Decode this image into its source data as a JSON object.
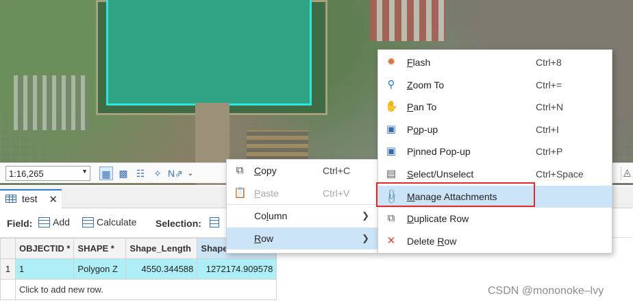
{
  "map": {
    "scale": "1:16,265"
  },
  "table_pane": {
    "tab_label": "test",
    "toolbar": {
      "field_label": "Field:",
      "add_label": "Add",
      "calculate_label": "Calculate",
      "selection_label": "Selection:"
    },
    "columns": [
      "OBJECTID *",
      "SHAPE *",
      "Shape_Length",
      "Shape_Area"
    ],
    "visible_column_headers": [
      "OBJECTID *",
      "SHAPE *",
      "Shape_Length",
      "Shape"
    ],
    "rows": [
      {
        "rownum": "1",
        "objectid": "1",
        "shape": "Polygon Z",
        "shape_length": "4550.344588",
        "shape_area": "1272174.909578"
      }
    ],
    "add_row_text": "Click to add new row."
  },
  "row_menu": {
    "items": [
      {
        "label": "Copy",
        "shortcut": "Ctrl+C",
        "icon": "copy-icon",
        "enabled": true
      },
      {
        "label": "Paste",
        "shortcut": "Ctrl+V",
        "icon": "paste-icon",
        "enabled": false
      },
      {
        "label": "Column",
        "submenu": true
      },
      {
        "label": "Row",
        "submenu": true,
        "highlighted": true
      }
    ]
  },
  "row_submenu": {
    "items": [
      {
        "label": "Flash",
        "shortcut": "Ctrl+8",
        "icon": "flash-icon"
      },
      {
        "label": "Zoom To",
        "shortcut": "Ctrl+=",
        "icon": "zoom-icon"
      },
      {
        "label": "Pan To",
        "shortcut": "Ctrl+N",
        "icon": "pan-hand-icon"
      },
      {
        "label": "Pop-up",
        "shortcut": "Ctrl+I",
        "icon": "popup-icon"
      },
      {
        "label": "Pinned Pop-up",
        "shortcut": "Ctrl+P",
        "icon": "pinned-popup-icon"
      },
      {
        "label": "Select/Unselect",
        "shortcut": "Ctrl+Space",
        "icon": "select-toggle-icon"
      },
      {
        "label": "Manage Attachments",
        "shortcut": "",
        "icon": "paperclip-icon",
        "highlighted": true
      },
      {
        "label": "Duplicate Row",
        "shortcut": "",
        "icon": "duplicate-icon"
      },
      {
        "label": "Delete Row",
        "shortcut": "",
        "icon": "delete-icon"
      }
    ]
  },
  "colors": {
    "polygon_fill": "#2fa383",
    "polygon_outline": "#2ee6dd",
    "selected_row": "#aeeef7",
    "menu_hover": "#cce4f7",
    "annotation_box": "#e0292b"
  },
  "watermark": "CSDN @mononoke–lvy"
}
